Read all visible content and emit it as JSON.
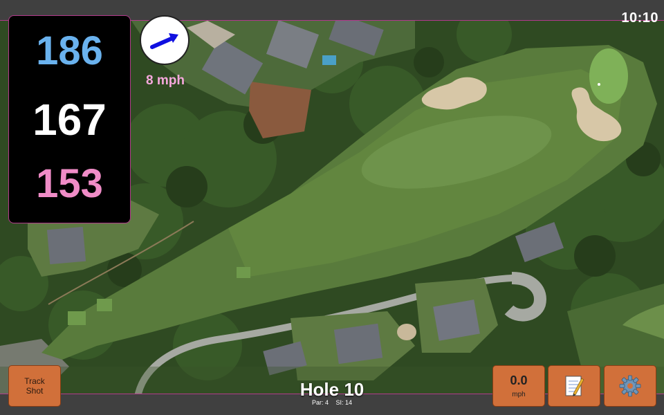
{
  "clock": "10:10",
  "yardages": {
    "back": "186",
    "center": "167",
    "front": "153"
  },
  "wind": {
    "speed_label": "8 mph",
    "direction_icon": "wind-arrow-icon",
    "arrow_color": "#1010e0"
  },
  "hole": {
    "title": "Hole 10",
    "par_label": "Par: 4",
    "si_label": "SI: 14"
  },
  "buttons": {
    "track_shot_line1": "Track",
    "track_shot_line2": "Shot",
    "speed_value": "0.0",
    "speed_unit": "mph",
    "notes_icon": "notepad-icon",
    "settings_icon": "gear-icon"
  },
  "colors": {
    "accent": "#b23a8c",
    "button": "#d1703a",
    "back_yardage": "#6ab2ee",
    "front_yardage": "#f08cc7"
  }
}
